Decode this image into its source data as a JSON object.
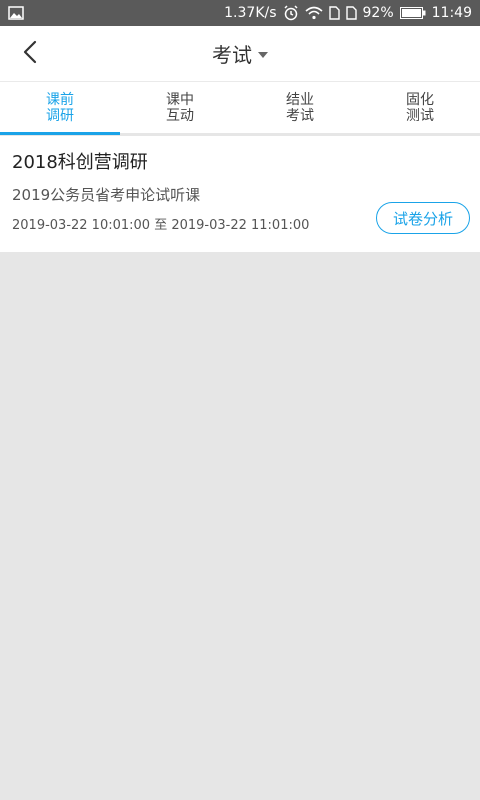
{
  "status_bar": {
    "speed": "1.37K/s",
    "battery_percent": "92%",
    "time": "11:49",
    "icons": [
      "image-icon",
      "alarm-icon",
      "wifi-icon",
      "sim-icon",
      "sim-icon",
      "battery-icon"
    ]
  },
  "header": {
    "title": "考试",
    "back_icon": "chevron-left-icon",
    "dropdown_icon": "caret-down-icon"
  },
  "tabs": [
    {
      "line1": "课前",
      "line2": "调研",
      "active": true
    },
    {
      "line1": "课中",
      "line2": "互动",
      "active": false
    },
    {
      "line1": "结业",
      "line2": "考试",
      "active": false
    },
    {
      "line1": "固化",
      "line2": "测试",
      "active": false
    }
  ],
  "colors": {
    "accent": "#1aa3e8",
    "background": "#e6e6e6",
    "status_bar": "#5a5a5a"
  },
  "card": {
    "title": "2018科创营调研",
    "subtitle": "2019公务员省考申论试听课",
    "time_range": "2019-03-22 10:01:00 至 2019-03-22 11:01:00",
    "action_label": "试卷分析"
  }
}
